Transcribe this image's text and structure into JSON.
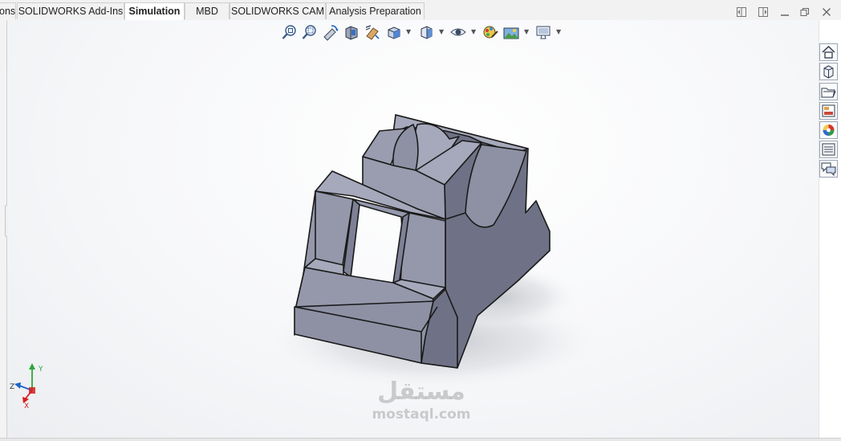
{
  "tabs": [
    {
      "label": "ons",
      "active": false
    },
    {
      "label": "SOLIDWORKS Add-Ins",
      "active": false
    },
    {
      "label": "Simulation",
      "active": true
    },
    {
      "label": "MBD",
      "active": false
    },
    {
      "label": "SOLIDWORKS CAM",
      "active": false
    },
    {
      "label": "Analysis Preparation",
      "active": false
    }
  ],
  "heads_up_toolbar": [
    "zoom-to-fit-icon",
    "zoom-to-area-icon",
    "previous-view-icon",
    "section-view-icon",
    "dynamic-annotation-icon",
    "view-orientation-icon",
    "display-style-icon",
    "hide-show-icon",
    "edit-appearance-icon",
    "apply-scene-icon",
    "view-settings-icon"
  ],
  "window_controls": [
    "tile-left-icon",
    "tile-right-icon",
    "minimize-icon",
    "restore-icon",
    "close-icon"
  ],
  "task_pane": [
    "home-icon",
    "design-library-icon",
    "file-explorer-icon",
    "view-palette-icon",
    "appearances-icon",
    "custom-properties-icon",
    "forum-icon"
  ],
  "triad": {
    "y": "Y",
    "z": "Z",
    "x": "X"
  },
  "watermark": {
    "arabic": "مستقل",
    "latin": "mostaql.com"
  },
  "colors": {
    "part_front": "#9598ab",
    "part_top": "#a6a9bb",
    "part_side": "#6f7286",
    "edge": "#1a1a1a",
    "viewport_bg": "#f4f5f7",
    "accent_blue": "#1d63c9"
  }
}
